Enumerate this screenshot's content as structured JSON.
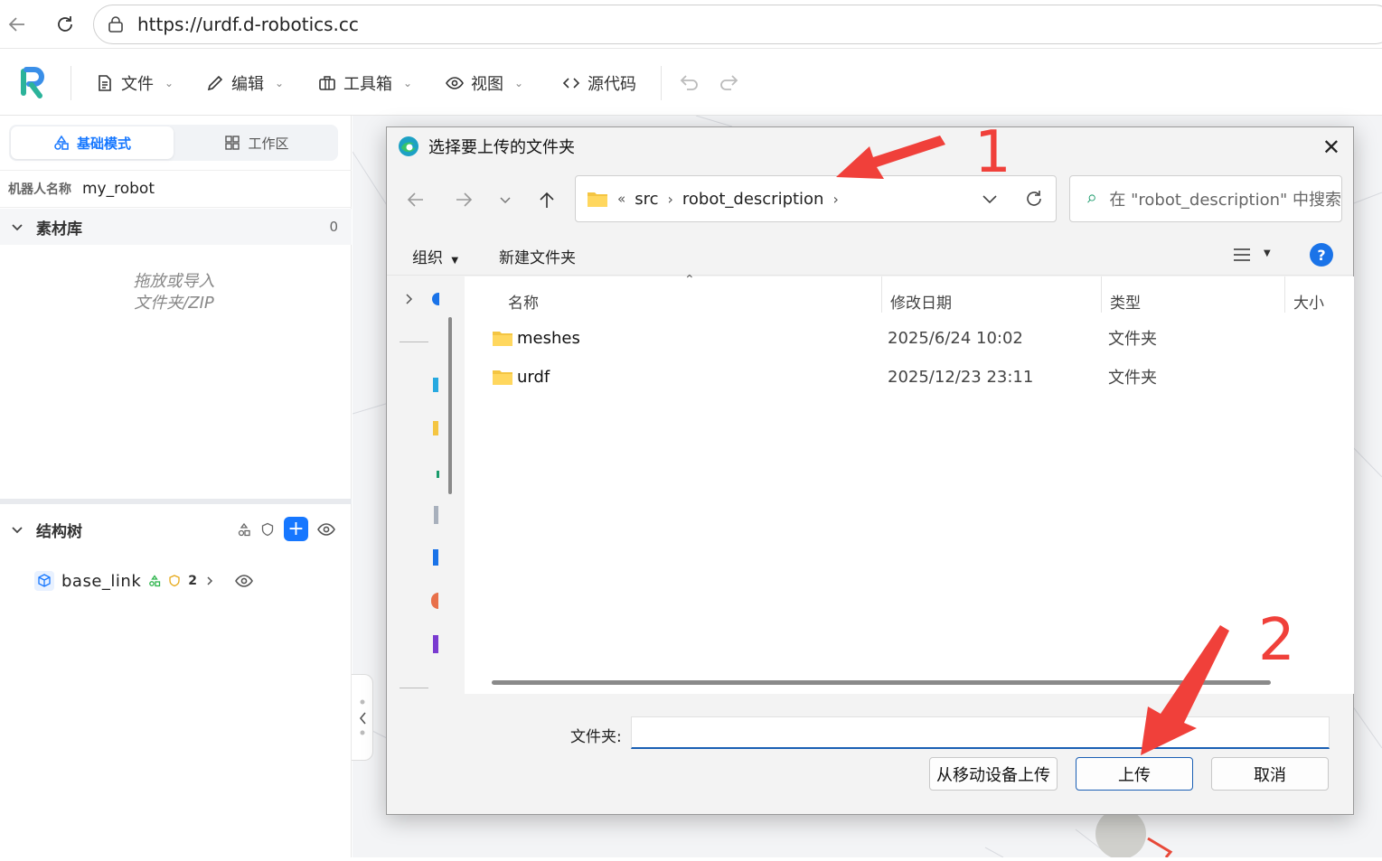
{
  "browser": {
    "url": "https://urdf.d-robotics.cc"
  },
  "toolbar": {
    "menus": [
      {
        "label": "文件"
      },
      {
        "label": "编辑"
      },
      {
        "label": "工具箱"
      },
      {
        "label": "视图"
      },
      {
        "label": "源代码"
      }
    ]
  },
  "left_panel": {
    "modes": {
      "basic": "基础模式",
      "workspace": "工作区"
    },
    "robot_name_label": "机器人名称",
    "robot_name_value": "my_robot",
    "library": {
      "title": "素材库",
      "count": "0",
      "hint_line1": "拖放或导入",
      "hint_line2": "文件夹/ZIP"
    },
    "tree": {
      "title": "结构树",
      "root_label": "base_link",
      "root_count": "2"
    }
  },
  "dialog": {
    "title": "选择要上传的文件夹",
    "breadcrumb_prefix": "«",
    "breadcrumb": [
      "src",
      "robot_description"
    ],
    "search_placeholder": "在 \"robot_description\" 中搜索",
    "organize": "组织",
    "new_folder": "新建文件夹",
    "columns": {
      "name": "名称",
      "date": "修改日期",
      "type": "类型",
      "size": "大小"
    },
    "files": [
      {
        "name": "meshes",
        "date": "2025/6/24 10:02",
        "type": "文件夹"
      },
      {
        "name": "urdf",
        "date": "2025/12/23 23:11",
        "type": "文件夹"
      }
    ],
    "folder_label": "文件夹:",
    "folder_value": "",
    "buttons": {
      "mobile": "从移动设备上传",
      "upload": "上传",
      "cancel": "取消"
    }
  },
  "annotations": {
    "marker1": "1",
    "marker2": "2"
  },
  "colors": {
    "accent": "#1677ff",
    "annotation": "#f0403a",
    "folder": "#f4c542"
  }
}
